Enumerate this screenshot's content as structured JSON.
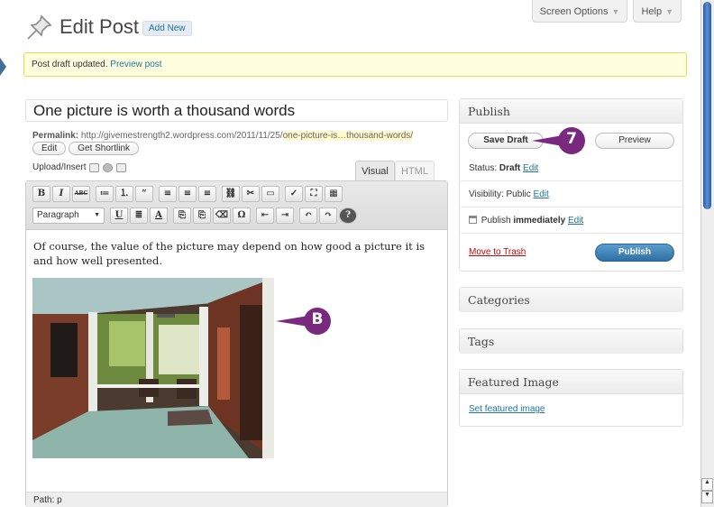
{
  "header": {
    "title": "Edit Post",
    "add_new": "Add New",
    "screen_options": "Screen Options",
    "help": "Help",
    "caret": "▼"
  },
  "notice": {
    "text": "Post draft updated.",
    "link": "Preview post"
  },
  "post": {
    "title": "One picture is worth a thousand words",
    "permalink_label": "Permalink:",
    "permalink_base": "http://givemestrength2.wordpress.com/2011/11/25/",
    "permalink_slug": "one-picture-is…thousand-words/",
    "edit_button": "Edit",
    "shortlink_button": "Get Shortlink",
    "upload_label": "Upload/Insert",
    "tab_visual": "Visual",
    "tab_html": "HTML",
    "paragraph_select": "Paragraph",
    "body_text": "Of course, the value of the picture may depend on how good a picture it is and how well presented.",
    "path": "Path: p"
  },
  "toolbar": {
    "row1": [
      "B",
      "I",
      "ABC",
      "≔",
      "⒈",
      "“",
      "≡",
      "≡",
      "≡",
      "⛓",
      "✂",
      "▭",
      "✓",
      "⛶",
      "▦"
    ],
    "row2": [
      "U",
      "≣",
      "A",
      "⎘",
      "⎘",
      "⌫",
      "Ω",
      "⇤",
      "⇥",
      "↶",
      "↷",
      "?"
    ]
  },
  "callouts": {
    "step": "7",
    "marker": "B"
  },
  "publish": {
    "title": "Publish",
    "save_draft": "Save Draft",
    "preview": "Preview",
    "status_label": "Status:",
    "status_value": "Draft",
    "visibility_label": "Visibility:",
    "visibility_value": "Public",
    "publish_label": "Publish",
    "publish_value": "immediately",
    "edit_link": "Edit",
    "move_to_trash": "Move to Trash",
    "publish_button": "Publish"
  },
  "sidebar": {
    "categories": "Categories",
    "tags": "Tags",
    "featured_image": "Featured Image",
    "set_featured_image": "Set featured image"
  },
  "colors": {
    "link": "#21759b",
    "callout": "#7a2a7e",
    "publish_button": "#2e6fa3",
    "trash": "#bc0b0b",
    "notice_bg": "#ffffe0"
  },
  "scrollbar": {
    "up": "▲",
    "down": "▼"
  }
}
